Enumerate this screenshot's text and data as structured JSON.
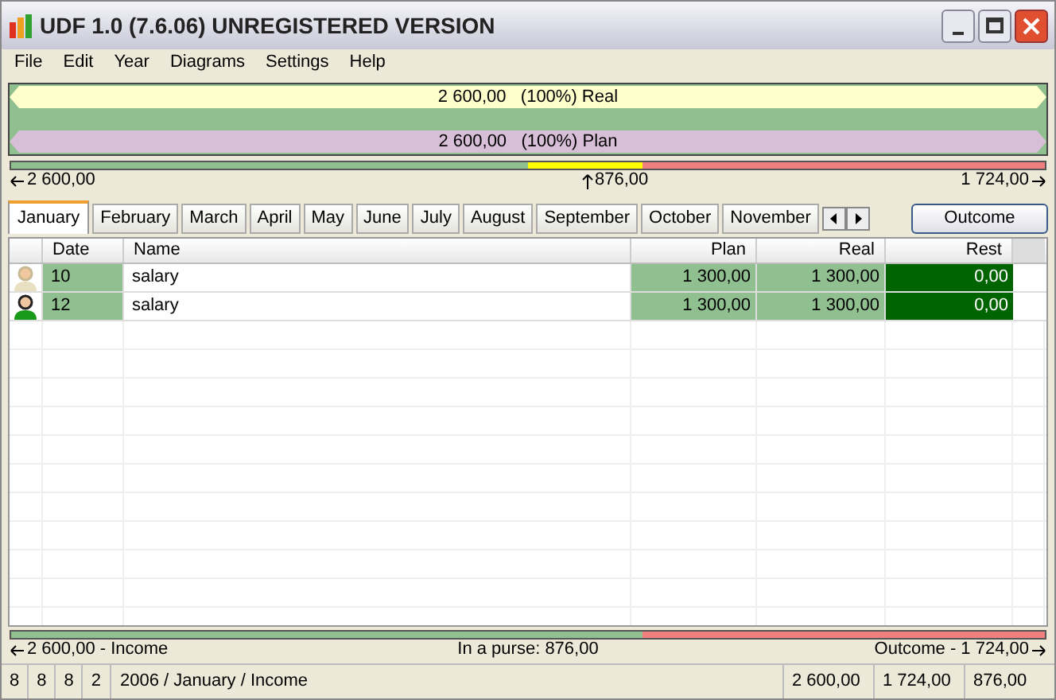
{
  "window": {
    "title": "UDF 1.0 (7.6.06) UNREGISTERED VERSION"
  },
  "menu": [
    "File",
    "Edit",
    "Year",
    "Diagrams",
    "Settings",
    "Help"
  ],
  "bars": [
    {
      "label": "2 600,00   (100%) Real",
      "color": "#ffffcc"
    },
    {
      "label": "2 600,00   (100%) Plan",
      "color": "#d8bfd8"
    }
  ],
  "balance": {
    "fills": [
      {
        "level": 0.61,
        "color": "#ffff00"
      },
      {
        "level": 0.5,
        "color": "#90c090"
      }
    ],
    "left": "2 600,00",
    "middle": "876,00",
    "right": "1 724,00"
  },
  "tabs": [
    {
      "label": "January",
      "selected": true
    },
    {
      "label": "February",
      "selected": false
    },
    {
      "label": "March",
      "selected": false
    },
    {
      "label": "April",
      "selected": false
    },
    {
      "label": "May",
      "selected": false
    },
    {
      "label": "June",
      "selected": false
    },
    {
      "label": "July",
      "selected": false
    },
    {
      "label": "August",
      "selected": false
    },
    {
      "label": "September",
      "selected": false
    },
    {
      "label": "October",
      "selected": false
    },
    {
      "label": "November",
      "selected": false
    }
  ],
  "outcome_button": "Outcome",
  "table": {
    "columns": [
      "Date",
      "Name",
      "Plan",
      "Real",
      "Rest"
    ],
    "rows": [
      {
        "kind": "light",
        "date": "10",
        "name": "salary",
        "plan": "1 300,00",
        "real": "1 300,00",
        "rest": "0,00"
      },
      {
        "kind": "green",
        "date": "12",
        "name": "salary",
        "plan": "1 300,00",
        "real": "1 300,00",
        "rest": "0,00"
      }
    ]
  },
  "summary": {
    "level": 0.61,
    "left": "2 600,00 - Income",
    "middle": "In a purse: 876,00",
    "right": "Outcome - 1 724,00"
  },
  "status_bar": {
    "counts": [
      "8",
      "8",
      "8",
      "2"
    ],
    "path": "2006 / January / Income",
    "totals": [
      "2 600,00",
      "1 724,00",
      "876,00"
    ]
  }
}
